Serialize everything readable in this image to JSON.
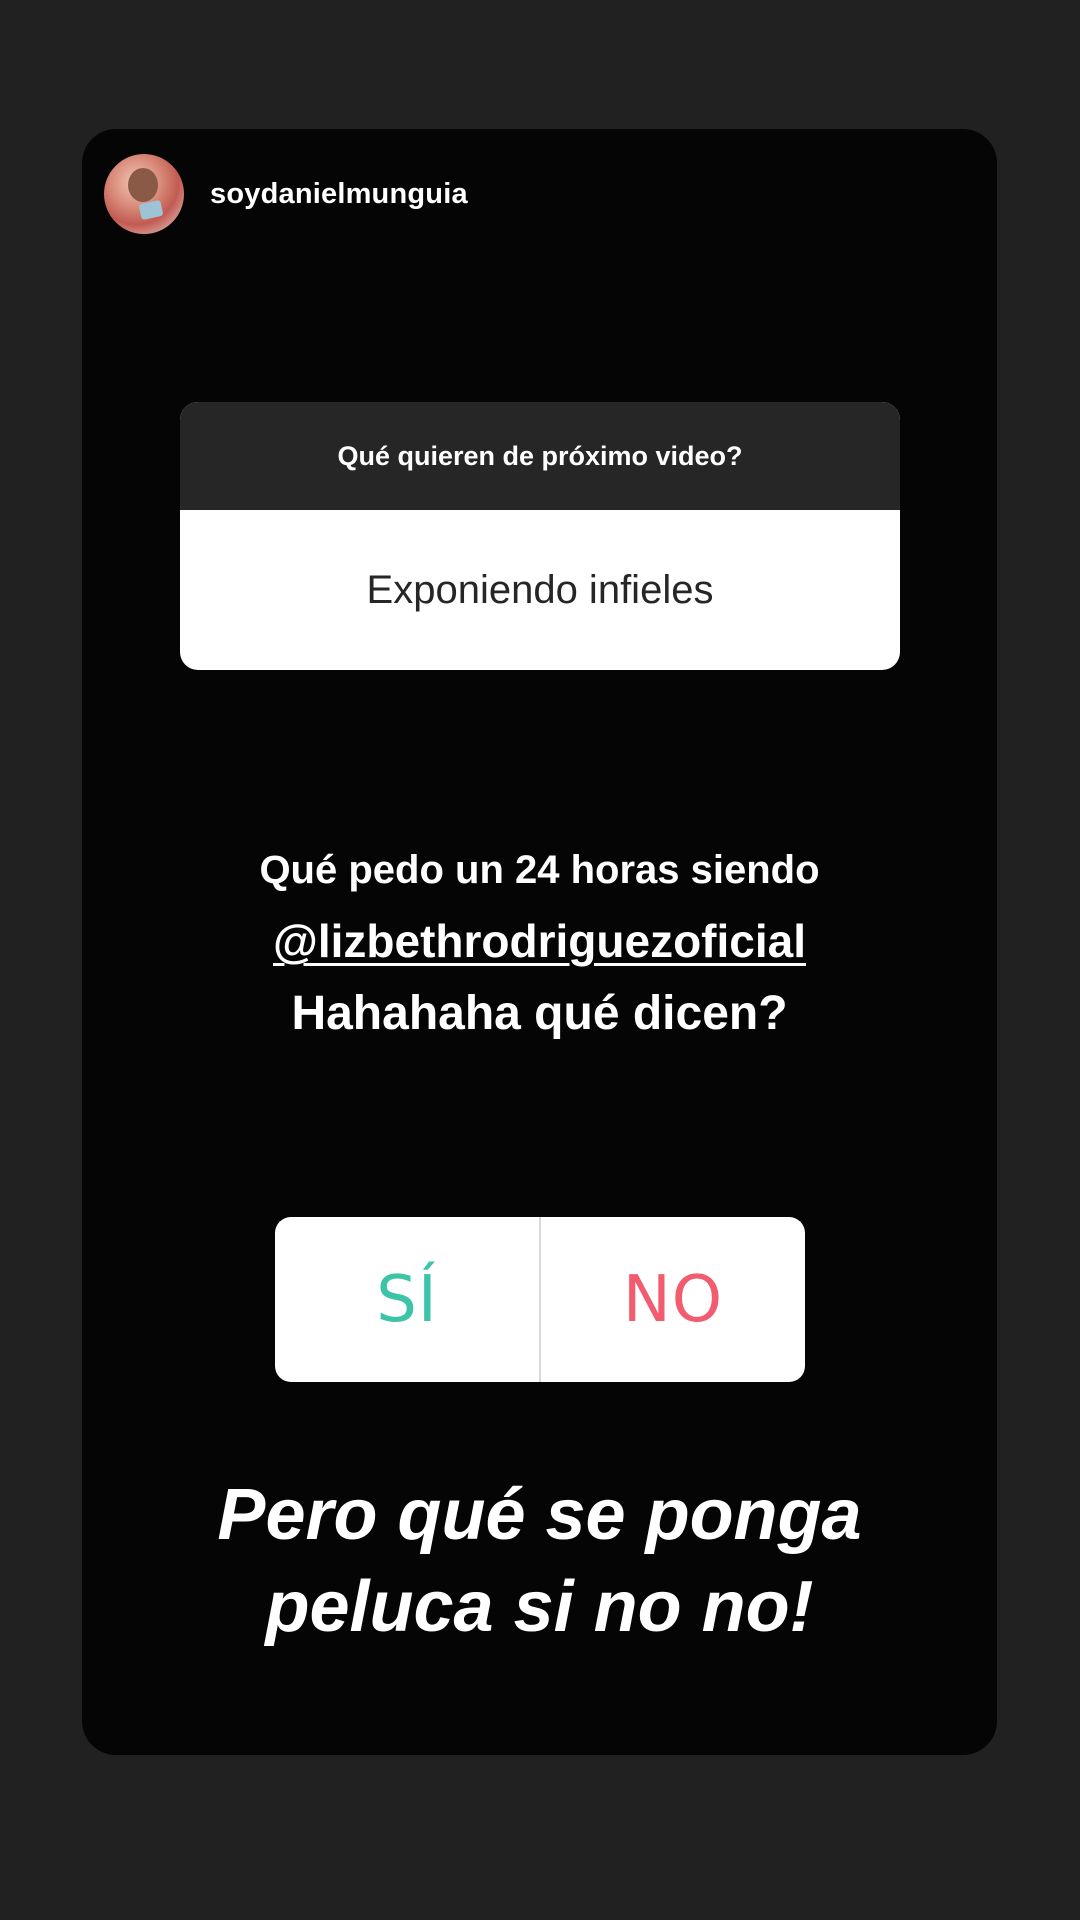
{
  "story": {
    "username": "soydanielmunguia"
  },
  "question_sticker": {
    "prompt": "Qué quieren de próximo video?",
    "answer": "Exponiendo infieles"
  },
  "caption": {
    "line1": "Qué pedo un 24 horas siendo",
    "mention": "@lizbethrodriguezoficial",
    "line3": "Hahahaha qué dicen?"
  },
  "poll": {
    "yes_label": "SÍ",
    "no_label": "NO",
    "colors": {
      "yes": "#3cc4a8",
      "no": "#f25c6f"
    }
  },
  "footer_caption": {
    "line1": "Pero qué se ponga",
    "line2": "peluca si no no!"
  },
  "icons": {
    "avatar": "profile-avatar"
  }
}
